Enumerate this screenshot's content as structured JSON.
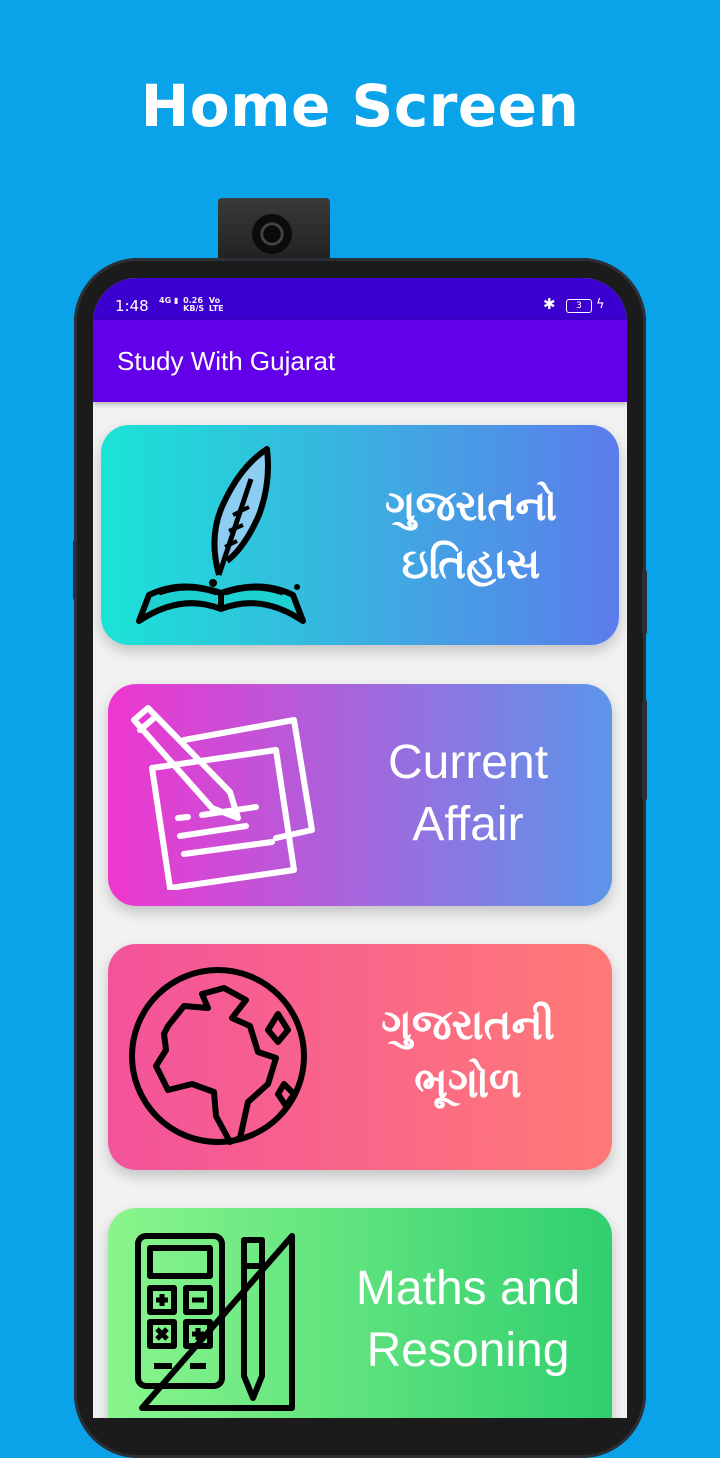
{
  "promo": {
    "title": "Home Screen"
  },
  "status_bar": {
    "time": "1:48",
    "network": "4G",
    "speed_line1": "0.26",
    "speed_line2": "KB/S",
    "carrier_line1": "Vo",
    "carrier_line2": "LTE",
    "battery": "3"
  },
  "app_bar": {
    "title": "Study With Gujarat"
  },
  "cards": [
    {
      "label_line1": "ગુજરાતનો",
      "label_line2": "ઇતિહાસ",
      "icon": "quill-book-icon",
      "gradient": [
        "#1be3d6",
        "#5c7cec"
      ]
    },
    {
      "label_line1": "Current",
      "label_line2": "Affair",
      "icon": "pencil-notes-icon",
      "gradient": [
        "#ef36cf",
        "#5b96ea"
      ]
    },
    {
      "label_line1": "ગુજરાતની",
      "label_line2": "ભૂગોળ",
      "icon": "globe-icon",
      "gradient": [
        "#f3539b",
        "#ff7a76"
      ]
    },
    {
      "label_line1": "Maths and",
      "label_line2": "Resoning",
      "icon": "calculator-ruler-icon",
      "gradient": [
        "#8af58c",
        "#30cf6f"
      ]
    }
  ],
  "colors": {
    "background": "#0aa3ea",
    "status_bar": "#3b00cf",
    "app_bar": "#6200ea"
  }
}
